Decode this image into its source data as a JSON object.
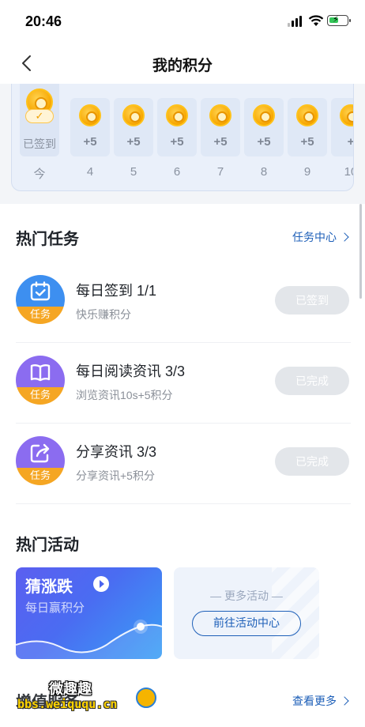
{
  "status_bar": {
    "time": "20:46"
  },
  "nav": {
    "title": "我的积分"
  },
  "checkin": {
    "today_label": "已签到",
    "today_day": "今",
    "days": [
      {
        "pts": "+5",
        "day": "4"
      },
      {
        "pts": "+5",
        "day": "5"
      },
      {
        "pts": "+5",
        "day": "6"
      },
      {
        "pts": "+5",
        "day": "7"
      },
      {
        "pts": "+5",
        "day": "8"
      },
      {
        "pts": "+5",
        "day": "9"
      },
      {
        "pts": "+",
        "day": "10"
      }
    ]
  },
  "hot_tasks": {
    "title": "热门任务",
    "link": "任务中心",
    "items": [
      {
        "name": "每日签到 1/1",
        "desc": "快乐赚积分",
        "badge": "任务",
        "button": "已签到",
        "color": "#3d8ff0"
      },
      {
        "name": "每日阅读资讯 3/3",
        "desc": "浏览资讯10s+5积分",
        "badge": "任务",
        "button": "已完成",
        "color": "#8b6cf0"
      },
      {
        "name": "分享资讯 3/3",
        "desc": "分享资讯+5积分",
        "badge": "任务",
        "button": "已完成",
        "color": "#8b6cf0"
      }
    ]
  },
  "hot_activities": {
    "title": "热门活动",
    "guess_card": {
      "title": "猜涨跌",
      "subtitle": "每日赢积分"
    },
    "more_card": {
      "label": "— 更多活动 —",
      "button": "前往活动中心"
    }
  },
  "bottom_section": {
    "title": "增值服务",
    "link": "查看更多"
  },
  "watermark": {
    "line1": "微趣趣",
    "line2": "bbs.weiququ.cn"
  }
}
